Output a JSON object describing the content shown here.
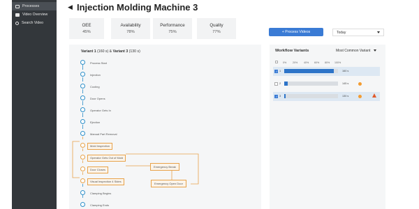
{
  "sidebar": {
    "items": [
      {
        "label": "Processes",
        "icon": "process-icon",
        "active": true
      },
      {
        "label": "Video Overview",
        "icon": "video-icon",
        "active": false
      },
      {
        "label": "Search Video",
        "icon": "search-icon",
        "active": false
      }
    ]
  },
  "header": {
    "title": "Injection Molding Machine 3",
    "back_icon": "back-arrow-icon"
  },
  "kpis": [
    {
      "label": "OEE",
      "value": "45%"
    },
    {
      "label": "Availability",
      "value": "78%"
    },
    {
      "label": "Performance",
      "value": "75%"
    },
    {
      "label": "Quality",
      "value": "77%"
    }
  ],
  "actions": {
    "process_videos": "+ Process Videos",
    "time_range": "Today"
  },
  "variant_panel": {
    "title_bold": "Variant 1",
    "title_rest": " (160 s) & ",
    "title_bold2": "Variant 3",
    "title_rest2": " (130 s)",
    "steps": [
      {
        "label": "Process Start",
        "highlight": false
      },
      {
        "label": "Injection",
        "highlight": false
      },
      {
        "label": "Cooling",
        "highlight": false
      },
      {
        "label": "Door Opens",
        "highlight": false
      },
      {
        "label": "Operator Gets In",
        "highlight": false
      },
      {
        "label": "Ejection",
        "highlight": false
      },
      {
        "label": "Manual Part Removal",
        "highlight": false
      },
      {
        "label": "Mold Inspection",
        "highlight": true
      },
      {
        "label": "Operator Gets Out of Mold",
        "highlight": true
      },
      {
        "label": "Door Closes",
        "highlight": true
      },
      {
        "label": "Visual Inspection 4 Sides",
        "highlight": true
      },
      {
        "label": "Clamping Begins",
        "highlight": false
      },
      {
        "label": "Clamping Ends",
        "highlight": false
      }
    ],
    "side_steps": [
      "Emergency Break",
      "Emergency Open Door"
    ]
  },
  "workflow": {
    "title": "Workflow Variants",
    "sort": "Most Common Variant",
    "axis": [
      "0%",
      "20%",
      "40%",
      "60%",
      "80%",
      "100%"
    ],
    "rows": [
      {
        "index": "1",
        "checked": true,
        "percent": 92,
        "duration": "160 s",
        "indicator": "none"
      },
      {
        "index": "2",
        "checked": false,
        "percent": 6,
        "duration": "145 s",
        "indicator": "dot"
      },
      {
        "index": "3",
        "checked": true,
        "percent": 2,
        "duration": "130 s",
        "indicator": "warning"
      }
    ]
  },
  "colors": {
    "accent": "#3a7bd5",
    "flow": "#2d8fc9",
    "highlight": "#e8a249",
    "warning": "#e05a2b"
  }
}
